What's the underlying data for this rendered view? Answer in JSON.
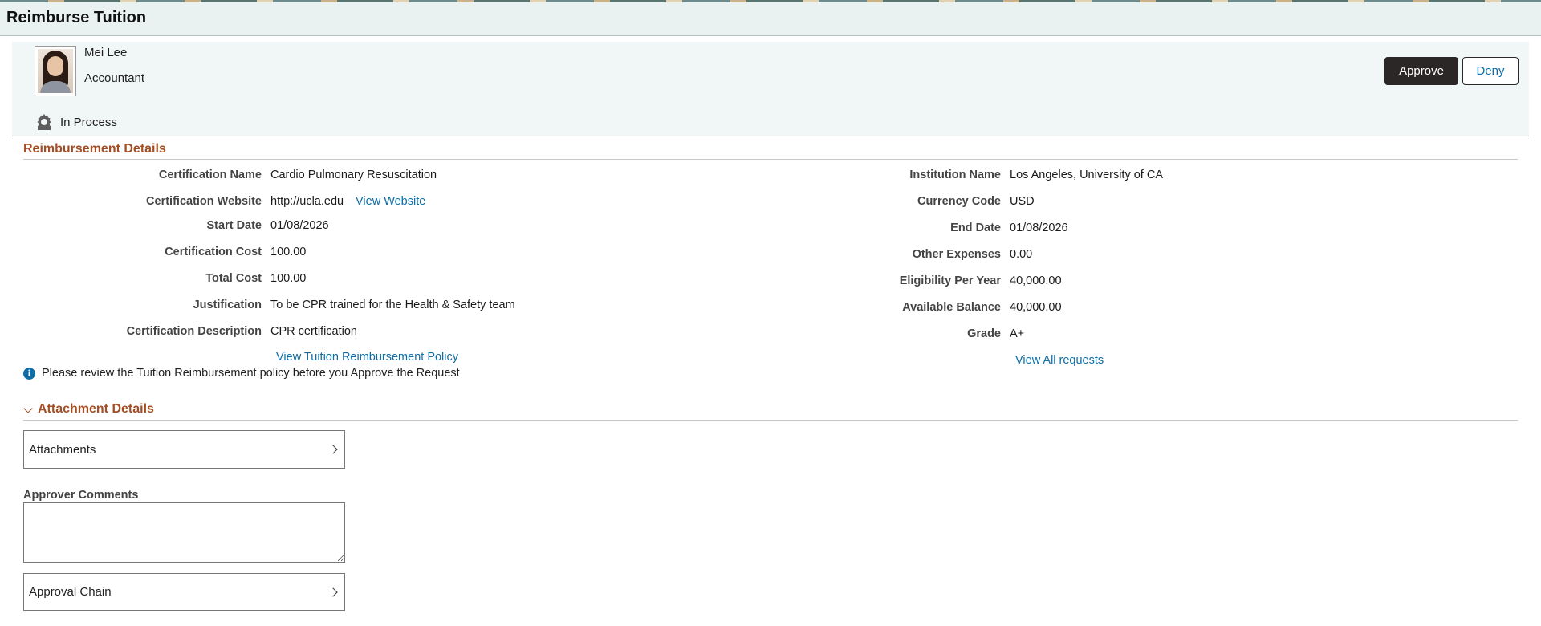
{
  "page": {
    "title": "Reimburse Tuition"
  },
  "employee": {
    "name": "Mei Lee",
    "job_title": "Accountant",
    "status": "In Process"
  },
  "actions": {
    "approve_label": "Approve",
    "deny_label": "Deny"
  },
  "reimbursement": {
    "section_title": "Reimbursement Details",
    "left": {
      "certification_name": {
        "label": "Certification Name",
        "value": "Cardio Pulmonary Resuscitation"
      },
      "certification_website": {
        "label": "Certification Website",
        "value": "http://ucla.edu",
        "link": "View Website"
      },
      "start_date": {
        "label": "Start Date",
        "value": "01/08/2026"
      },
      "certification_cost": {
        "label": "Certification Cost",
        "value": "100.00"
      },
      "total_cost": {
        "label": "Total Cost",
        "value": "100.00"
      },
      "justification": {
        "label": "Justification",
        "value": "To be CPR trained for the Health & Safety team"
      },
      "certification_description": {
        "label": "Certification Description",
        "value": "CPR certification"
      },
      "policy_link": "View Tuition Reimbursement Policy"
    },
    "right": {
      "institution_name": {
        "label": "Institution Name",
        "value": "Los Angeles, University of CA"
      },
      "currency_code": {
        "label": "Currency Code",
        "value": "USD"
      },
      "end_date": {
        "label": "End Date",
        "value": "01/08/2026"
      },
      "other_expenses": {
        "label": "Other Expenses",
        "value": "0.00"
      },
      "eligibility_per_year": {
        "label": "Eligibility Per Year",
        "value": "40,000.00"
      },
      "available_balance": {
        "label": "Available Balance",
        "value": "40,000.00"
      },
      "grade": {
        "label": "Grade",
        "value": "A+"
      },
      "view_all_link": "View All requests"
    },
    "info_message": "Please review the Tuition Reimbursement policy before you Approve the Request"
  },
  "attachment_details": {
    "section_title": "Attachment Details",
    "attachments_label": "Attachments",
    "comments_label": "Approver Comments",
    "comments_value": "",
    "approval_chain_label": "Approval Chain"
  },
  "colors": {
    "accent": "#a34e25",
    "link": "#0e6ea8",
    "primary_button": "#2b2726",
    "header_bg": "#e9f1f1"
  }
}
